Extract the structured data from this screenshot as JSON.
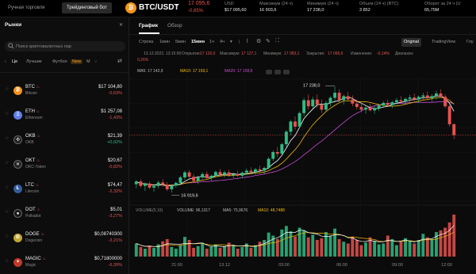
{
  "topbar": {
    "modes": [
      "Ручная торговля",
      "Трейдинговый бот"
    ],
    "pair": "BTC/USDT",
    "coin_symbol": "₿",
    "price": "17 095,6",
    "change": "-0,65%",
    "stats": [
      {
        "label": "USD",
        "value": "$17 095,60"
      },
      {
        "label": "Максимум (24 ч)",
        "value": "16 903,6"
      },
      {
        "label": "Минимум (24 ч)",
        "value": "17 238,0"
      },
      {
        "label": "Объем (24 ч) (BTC)",
        "value": "3 852"
      },
      {
        "label": "Оборот за 24 ч (U",
        "value": "65,75М"
      }
    ]
  },
  "sidebar": {
    "title": "Рынки",
    "search_placeholder": "Поиск криптовалютных пар",
    "categories": [
      "Це",
      "Лучшие",
      "Футбол",
      "New",
      "М"
    ],
    "coins": [
      {
        "symbol": "BTC",
        "name": "Bitcoin",
        "price": "$17 104,80",
        "change": "-0,63%",
        "dir": "down",
        "color": "#f7931a",
        "glyph": "₿"
      },
      {
        "symbol": "ETH",
        "name": "Ethereum",
        "price": "$1 257,08",
        "change": "-1,43%",
        "dir": "down",
        "color": "#627eea",
        "glyph": "Ξ"
      },
      {
        "symbol": "OKB",
        "name": "OKB",
        "price": "$21,39",
        "change": "+0,92%",
        "dir": "up",
        "color": "#222222",
        "glyph": "✣"
      },
      {
        "symbol": "OKT",
        "name": "OKC-Token",
        "price": "$20,67",
        "change": "-0,82%",
        "dir": "down",
        "color": "#222222",
        "glyph": "✕"
      },
      {
        "symbol": "LTC",
        "name": "Litecoin",
        "price": "$74,47",
        "change": "-2,32%",
        "dir": "down",
        "color": "#345d9d",
        "glyph": "Ł"
      },
      {
        "symbol": "DOT",
        "name": "Polkadot",
        "price": "$5,01",
        "change": "-3,27%",
        "dir": "down",
        "color": "#1a1a1a",
        "glyph": "●"
      },
      {
        "symbol": "DOGE",
        "name": "Dogecoin",
        "price": "$0,08740300",
        "change": "-3,21%",
        "dir": "down",
        "color": "#c2a633",
        "glyph": "Ð"
      },
      {
        "symbol": "MAGIC",
        "name": "Magic",
        "price": "$0,71800000",
        "change": "-6,39%",
        "dir": "down",
        "color": "#c0392b",
        "glyph": "✦"
      }
    ]
  },
  "chart_tabs": [
    "График",
    "Обзор"
  ],
  "toolbar": {
    "intervals": [
      "Строка",
      "1мин",
      "5мин",
      "15мин",
      "1ч",
      "4ч"
    ],
    "active_interval": "15мин",
    "views": [
      "Original",
      "TradingView",
      "Глу"
    ]
  },
  "ohlc": {
    "date": "13.12.2022, 13:15:00",
    "open_label": "Открытие:",
    "open": "17 120,0",
    "high_label": "Максимум:",
    "high": "17 127,1",
    "low_label": "Минимум:",
    "low": "17 083,1",
    "close_label": "Закрытие:",
    "close": "17 095,6",
    "change_label": "Изменение:",
    "change": "-0,14%",
    "range_label": "Диапазон:",
    "range": "0,26%"
  },
  "ma_legend": {
    "ma5": "MA5: 17 142,9",
    "ma10": "MA10: 17 159,1",
    "ma20": "MA20: 17 158,8"
  },
  "volume_legend": {
    "title": "VOLUME(5,10)",
    "volume": "VOLUME: 96,1317",
    "ma5": "MA5: 75,9676",
    "ma10": "MA10: 48,7488"
  },
  "colors": {
    "up": "#2ebd85",
    "down": "#e8524f",
    "ma5": "#ffffff",
    "ma10": "#f0b90b",
    "ma20": "#c34bd1"
  },
  "chart_data": {
    "type": "candlestick",
    "series": [
      {
        "name": "MA5",
        "values": []
      },
      {
        "name": "MA10",
        "values": []
      },
      {
        "name": "MA20",
        "values": []
      }
    ],
    "annotations": {
      "high_marker": "17 238,0",
      "low_marker": "16 919,6"
    },
    "x_ticks": [
      "21:00",
      "13.12",
      "03:00",
      "06:00",
      "09:00",
      "12:00"
    ],
    "candles": [
      [
        16950,
        16962,
        16938,
        16958
      ],
      [
        16958,
        16964,
        16940,
        16945
      ],
      [
        16945,
        16955,
        16930,
        16952
      ],
      [
        16952,
        16958,
        16935,
        16940
      ],
      [
        16940,
        16950,
        16928,
        16945
      ],
      [
        16945,
        16960,
        16938,
        16955
      ],
      [
        16955,
        16965,
        16942,
        16948
      ],
      [
        16948,
        16956,
        16930,
        16935
      ],
      [
        16935,
        16950,
        16925,
        16946
      ],
      [
        16946,
        16958,
        16940,
        16954
      ],
      [
        16954,
        16975,
        16948,
        16970
      ],
      [
        16970,
        16990,
        16962,
        16985
      ],
      [
        16985,
        16992,
        16968,
        16972
      ],
      [
        16972,
        16980,
        16955,
        16960
      ],
      [
        16960,
        16975,
        16950,
        16970
      ],
      [
        16970,
        16985,
        16965,
        16980
      ],
      [
        16980,
        16988,
        16966,
        16968
      ],
      [
        16968,
        16978,
        16960,
        16975
      ],
      [
        16975,
        16990,
        16970,
        16986
      ],
      [
        16986,
        16995,
        16975,
        16978
      ],
      [
        16978,
        16990,
        16970,
        16985
      ],
      [
        16985,
        16992,
        16972,
        16976
      ],
      [
        16976,
        16985,
        16968,
        16980
      ],
      [
        16980,
        16990,
        16972,
        16975
      ],
      [
        16975,
        16988,
        16968,
        16984
      ],
      [
        16984,
        16996,
        16978,
        16990
      ],
      [
        16990,
        17000,
        16982,
        16985
      ],
      [
        16985,
        16998,
        16978,
        16994
      ],
      [
        16994,
        17005,
        16985,
        16990
      ],
      [
        16990,
        17002,
        16980,
        16998
      ],
      [
        16998,
        17030,
        16994,
        17025
      ],
      [
        17025,
        17050,
        17018,
        17045
      ],
      [
        17045,
        17060,
        17030,
        17040
      ],
      [
        17040,
        17072,
        17036,
        17068
      ],
      [
        17068,
        17110,
        17060,
        17105
      ],
      [
        17105,
        17140,
        17095,
        17135
      ],
      [
        17135,
        17150,
        17110,
        17120
      ],
      [
        17120,
        17165,
        17115,
        17160
      ],
      [
        17160,
        17205,
        17150,
        17198
      ],
      [
        17198,
        17215,
        17170,
        17180
      ],
      [
        17180,
        17208,
        17172,
        17200
      ],
      [
        17200,
        17215,
        17175,
        17185
      ],
      [
        17185,
        17200,
        17160,
        17170
      ],
      [
        17170,
        17196,
        17165,
        17190
      ],
      [
        17190,
        17210,
        17180,
        17205
      ],
      [
        17205,
        17238,
        17195,
        17220
      ],
      [
        17220,
        17230,
        17190,
        17198
      ],
      [
        17198,
        17215,
        17185,
        17210
      ],
      [
        17210,
        17222,
        17195,
        17200
      ],
      [
        17200,
        17212,
        17180,
        17188
      ],
      [
        17188,
        17200,
        17170,
        17178
      ],
      [
        17178,
        17190,
        17162,
        17170
      ],
      [
        17170,
        17182,
        17158,
        17176
      ],
      [
        17176,
        17188,
        17165,
        17168
      ],
      [
        17168,
        17180,
        17158,
        17174
      ],
      [
        17174,
        17188,
        17166,
        17182
      ],
      [
        17182,
        17195,
        17175,
        17190
      ],
      [
        17190,
        17200,
        17178,
        17184
      ],
      [
        17184,
        17196,
        17175,
        17192
      ],
      [
        17192,
        17205,
        17185,
        17198
      ],
      [
        17198,
        17210,
        17188,
        17194
      ],
      [
        17194,
        17206,
        17185,
        17202
      ],
      [
        17202,
        17214,
        17192,
        17206
      ],
      [
        17206,
        17218,
        17196,
        17200
      ],
      [
        17200,
        17212,
        17190,
        17208
      ],
      [
        17208,
        17220,
        17198,
        17212
      ],
      [
        17212,
        17224,
        17200,
        17204
      ],
      [
        17204,
        17216,
        17194,
        17210
      ],
      [
        17210,
        17226,
        17200,
        17218
      ],
      [
        17218,
        17230,
        17205,
        17208
      ],
      [
        17208,
        17215,
        17175,
        17180
      ],
      [
        17180,
        17185,
        17120,
        17127
      ],
      [
        17127,
        17130,
        17083,
        17095
      ]
    ],
    "volumes": [
      30,
      22,
      18,
      25,
      20,
      28,
      35,
      40,
      22,
      18,
      26,
      45,
      38,
      20,
      24,
      30,
      18,
      22,
      28,
      20,
      24,
      32,
      26,
      18,
      22,
      30,
      20,
      26,
      34,
      38,
      55,
      48,
      40,
      62,
      70,
      58,
      46,
      66,
      60,
      44,
      50,
      38,
      42,
      56,
      48,
      64,
      40,
      34,
      30,
      46,
      38,
      26,
      32,
      44,
      36,
      28,
      30,
      48,
      40,
      26,
      34,
      42,
      36,
      30,
      38,
      52,
      44,
      40,
      56,
      60,
      66,
      78,
      96
    ]
  }
}
